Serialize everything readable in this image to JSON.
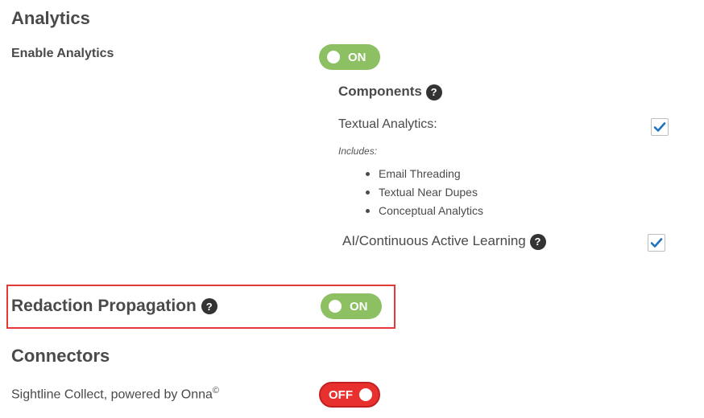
{
  "analytics": {
    "title": "Analytics",
    "enable_label": "Enable Analytics",
    "enable_toggle": "ON",
    "components_title": "Components",
    "help_glyph": "?",
    "textual_label": "Textual Analytics:",
    "textual_checked": true,
    "includes_label": "Includes:",
    "includes": [
      "Email Threading",
      "Textual Near Dupes",
      "Conceptual Analytics"
    ],
    "ai_label": "AI/Continuous Active Learning",
    "ai_checked": true
  },
  "redaction": {
    "title": "Redaction Propagation",
    "toggle": "ON"
  },
  "connectors": {
    "title": "Connectors",
    "sightline_label": "Sightline Collect, powered by Onna",
    "sightline_sup": "©",
    "sightline_toggle": "OFF"
  },
  "colors": {
    "on_green": "#8cc063",
    "off_red": "#e8312f",
    "check_blue": "#1e73be",
    "highlight_red": "#e53935"
  }
}
